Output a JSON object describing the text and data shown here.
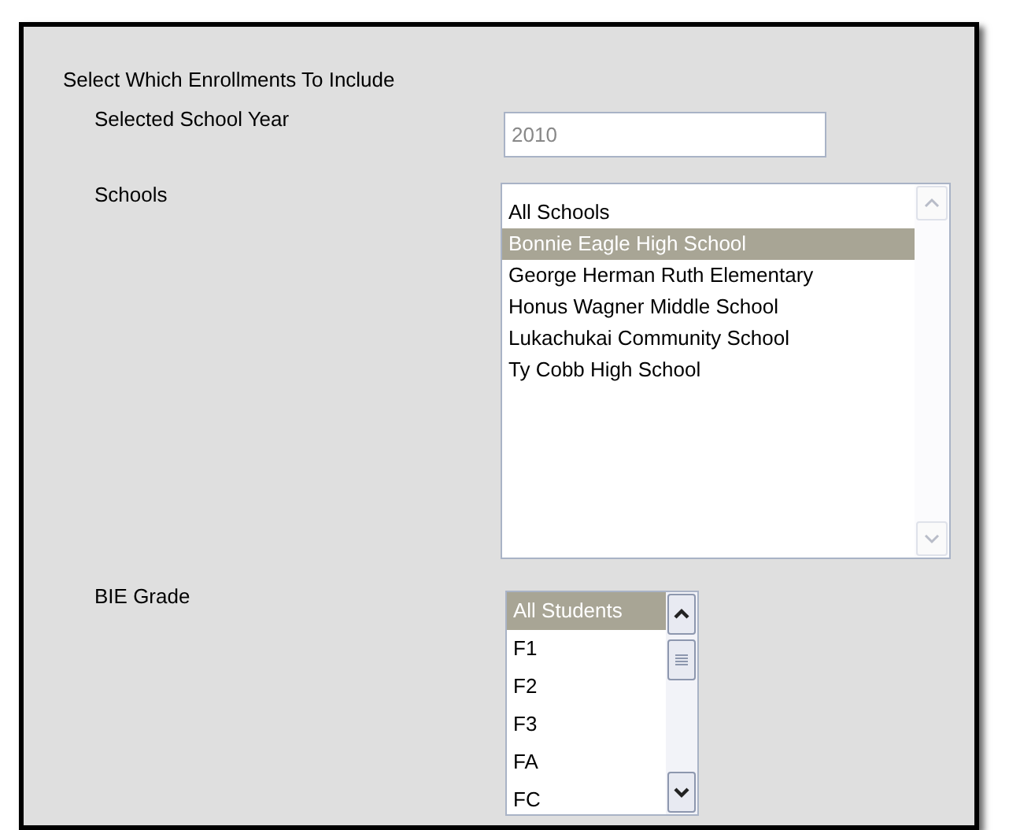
{
  "section": {
    "title": "Select Which Enrollments To Include"
  },
  "fields": [
    {
      "kind": "text",
      "label": "Selected School Year",
      "value": "2010",
      "disabled": true
    },
    {
      "kind": "list",
      "label": "Schools",
      "options": [
        {
          "label": "All Schools",
          "selected": false
        },
        {
          "label": "Bonnie Eagle High School",
          "selected": true
        },
        {
          "label": "George Herman Ruth Elementary",
          "selected": false
        },
        {
          "label": "Honus Wagner Middle School",
          "selected": false
        },
        {
          "label": "Lukachukai Community School",
          "selected": false
        },
        {
          "label": "Ty Cobb High School",
          "selected": false
        }
      ]
    },
    {
      "kind": "list",
      "label": "BIE Grade",
      "options": [
        {
          "label": "All Students",
          "selected": true
        },
        {
          "label": "F1",
          "selected": false
        },
        {
          "label": "F2",
          "selected": false
        },
        {
          "label": "F3",
          "selected": false
        },
        {
          "label": "FA",
          "selected": false
        },
        {
          "label": "FC",
          "selected": false
        }
      ]
    }
  ]
}
